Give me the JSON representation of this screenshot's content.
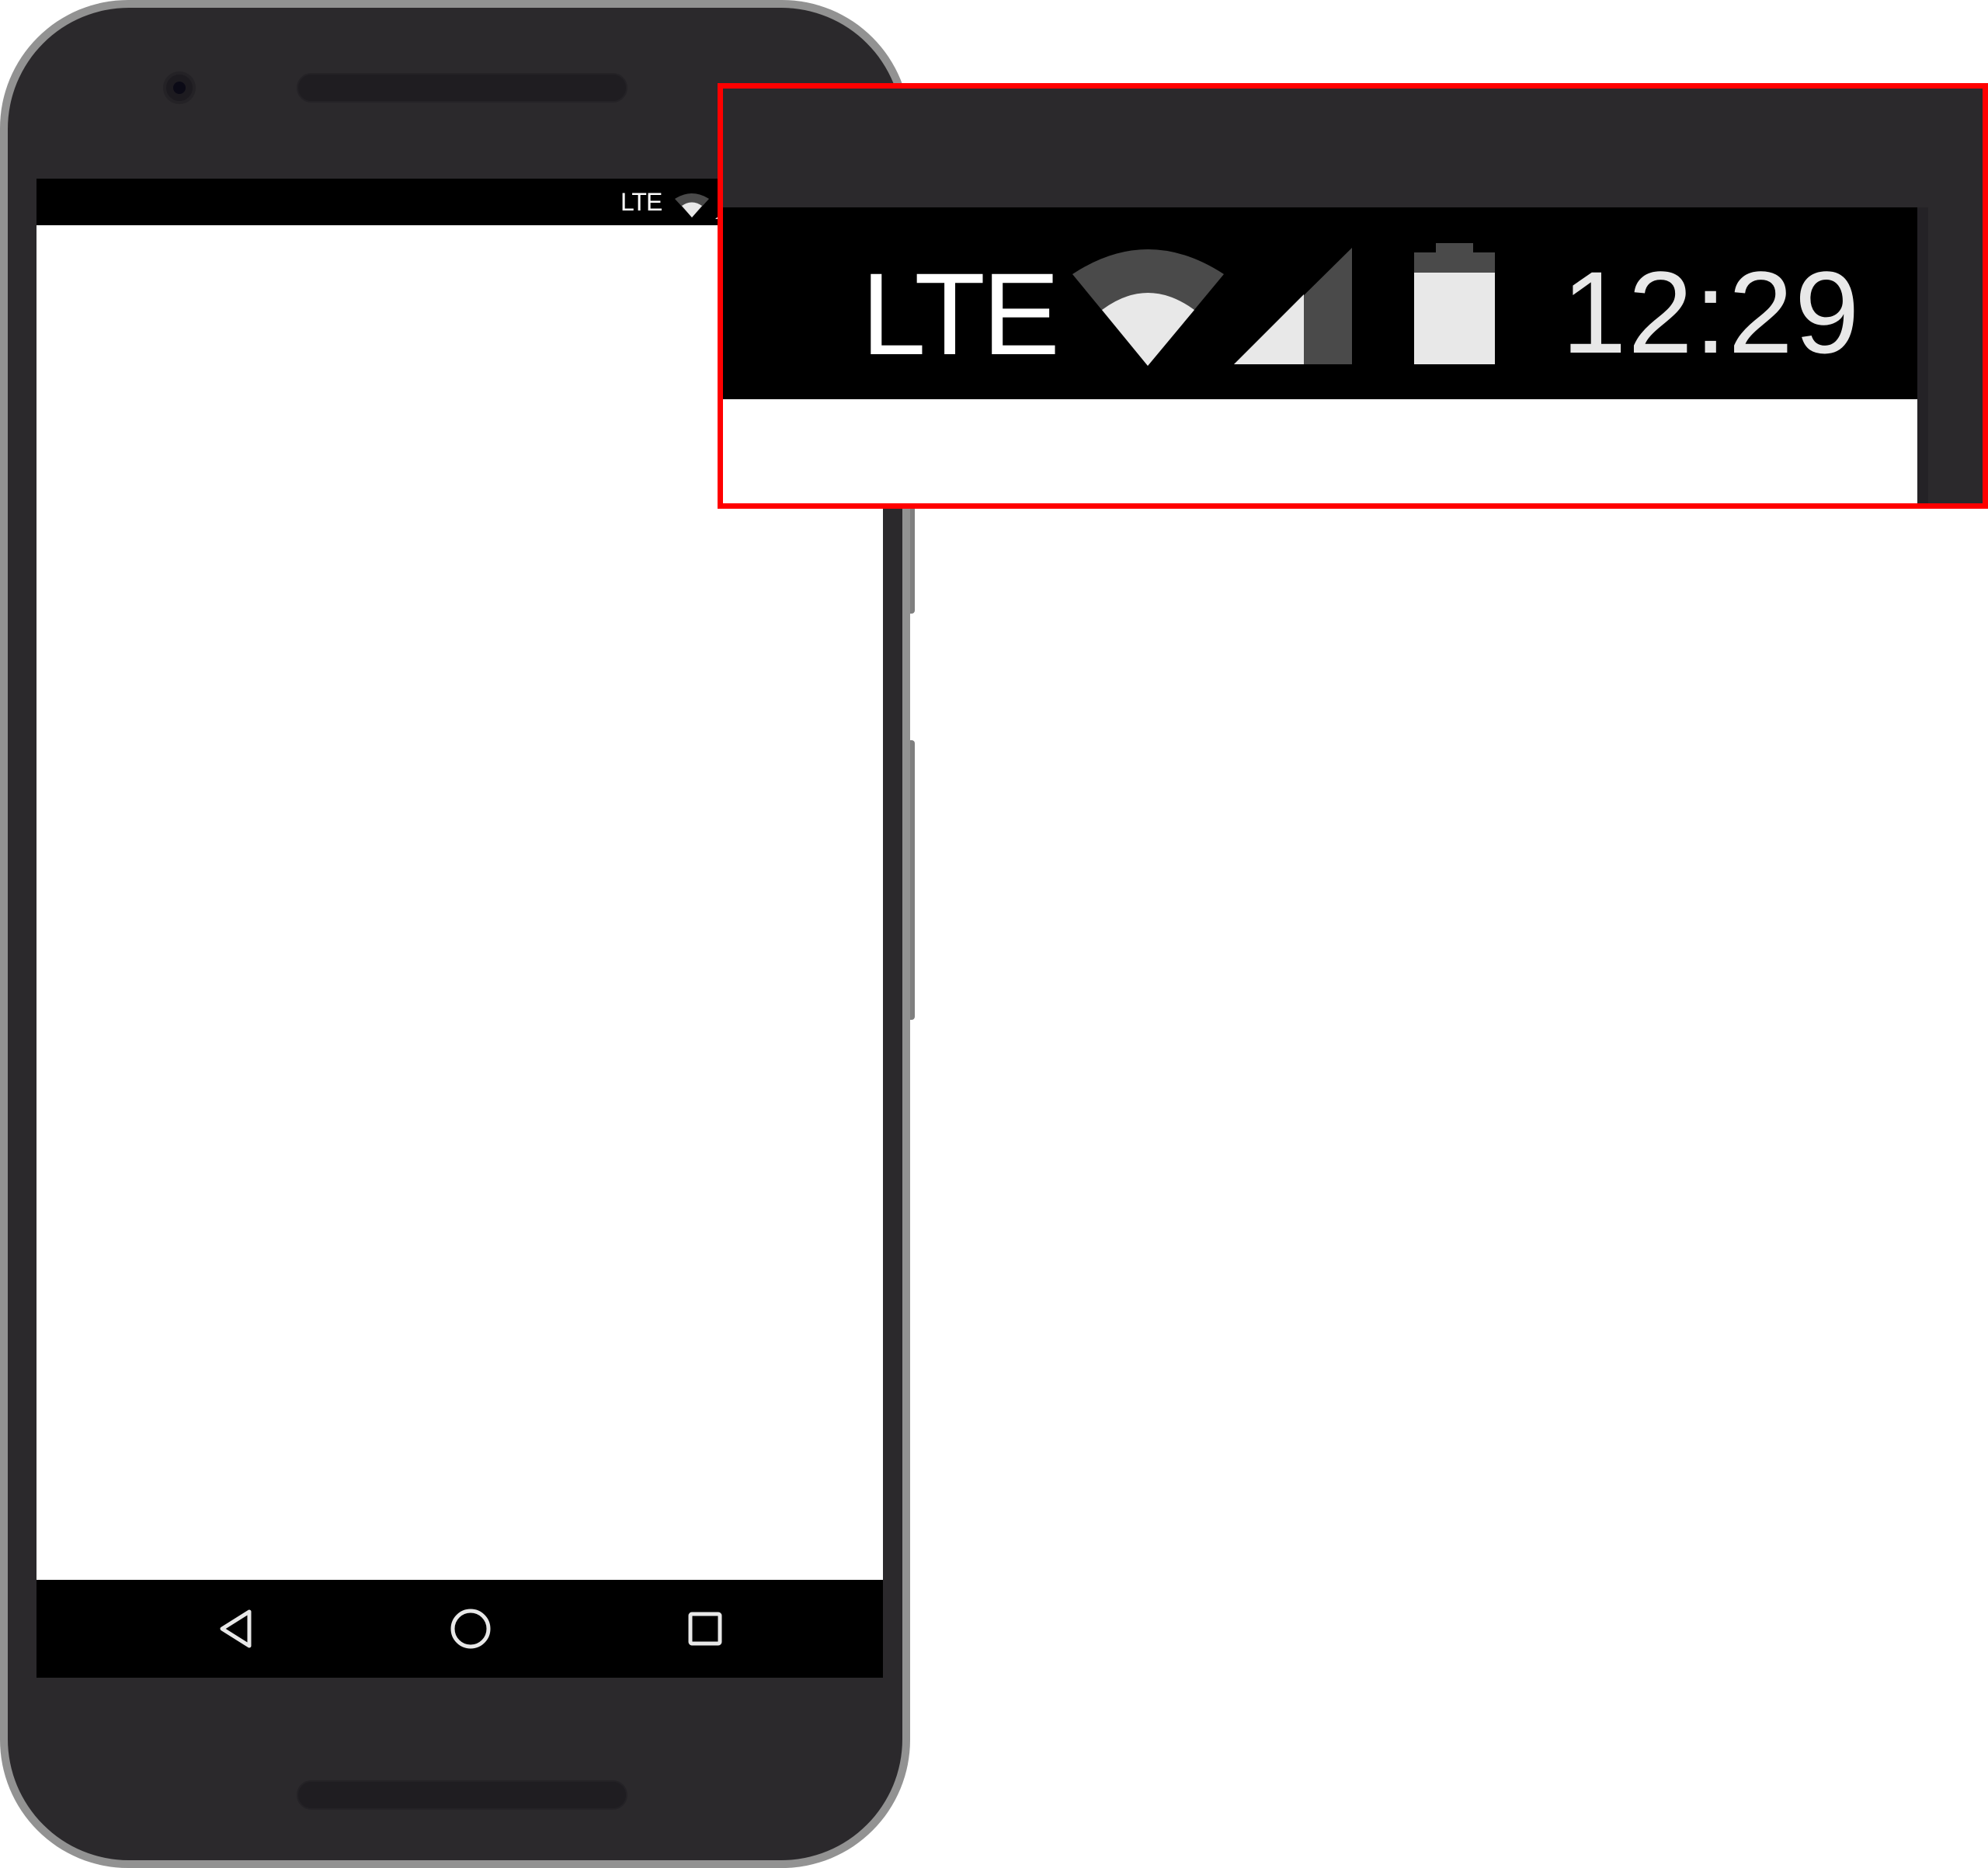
{
  "status_bar": {
    "network_label": "LTE",
    "time": "12:29"
  },
  "icons": {
    "wifi": "wifi-icon",
    "signal": "cellular-signal-icon",
    "battery": "battery-icon",
    "back": "back-triangle-icon",
    "home": "home-circle-icon",
    "recents": "recents-square-icon"
  },
  "colors": {
    "device_body": "#2b292c",
    "device_rim": "#929292",
    "status_bar": "#000000",
    "screen": "#ffffff",
    "highlight_border": "#ff0000",
    "icon_active": "#e8e8e8",
    "icon_inactive": "#4a4a4a"
  }
}
